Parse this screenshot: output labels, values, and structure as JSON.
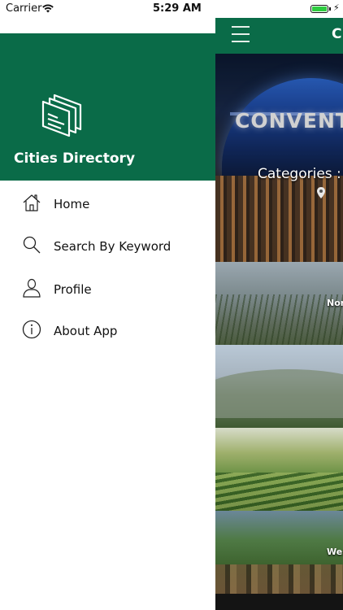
{
  "status_bar": {
    "carrier": "Carrier",
    "time": "5:29 AM"
  },
  "drawer": {
    "app_name": "Cities Directory",
    "menu_items": [
      {
        "label": "Home",
        "icon": "home-icon"
      },
      {
        "label": "Search By Keyword",
        "icon": "search-icon"
      },
      {
        "label": "Profile",
        "icon": "person-icon"
      },
      {
        "label": "About App",
        "icon": "info-icon"
      }
    ]
  },
  "main": {
    "title": "C",
    "hero_sign": "CONVENTIO",
    "hero_categories": "Categories :",
    "tiles": [
      {
        "label": "Nor"
      },
      {
        "label": ""
      },
      {
        "label": ""
      },
      {
        "label": "Wes"
      }
    ]
  },
  "colors": {
    "brand_green": "#0a6b48",
    "battery_green": "#2ecc40"
  }
}
